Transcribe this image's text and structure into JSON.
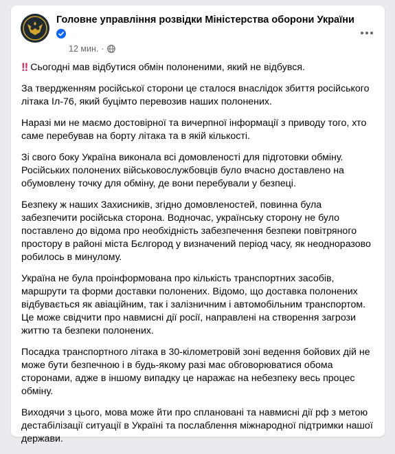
{
  "post": {
    "author": "Головне управління розвідки Міністерства оборони України",
    "verified": true,
    "time": "12 мин.",
    "separator": "·",
    "audience_icon": "globe-icon",
    "more_icon": "more-options-icon",
    "emoji": "‼",
    "paragraphs": [
      "Сьогодні мав відбутися обмін полоненими, який не відбувся.",
      "За твердженням російської сторони це сталося внаслідок збиття російського літака Іл-76, який буцімто перевозив наших полонених.",
      "Наразі ми не маємо достовірної та вичерпної інформації з приводу того, хто саме перебував на борту літака та в якій кількості.",
      "Зі свого боку Україна виконала всі домовленості для підготовки обміну. Російських полонених військовослужбовців було вчасно доставлено на обумовлену точку для обміну, де вони перебували у безпеці.",
      "Безпеку ж наших Захисників, згідно домовленостей, повинна була забезпечити російська сторона. Водночас, українську сторону не було поставлено до відома про необхідність забезпечення безпеки повітряного простору в районі міста Бєлгород у визначений період часу, як неодноразово робилось в минулому.",
      "Україна не була проінформована про кількість транспортних засобів, маршрути та форми доставки полонених. Відомо, що доставка полонених відбувається як авіаційним, так і залізничним і автомобільним транспортом. Це може свідчити про навмисні дії росії, направлені на створення загрози життю та безпеки полонених.",
      "Посадка транспортного літака в 30-кілометровій зоні ведення бойових дій не може бути безпечною і в будь-якому разі має обговорюватися обома сторонами, адже в іншому випадку це наражає на небезпеку весь процес обміну.",
      "Виходячи з цього, мова може йти про сплановані та навмисні дії рф з метою дестабілізації ситуації в Україні та послаблення міжнародної підтримки нашої держави."
    ]
  },
  "colors": {
    "background": "#e9ebee",
    "card": "#ffffff",
    "text": "#050505",
    "meta": "#65676b",
    "verified_badge": "#0866ff",
    "emoji": "#e0245e",
    "avatar_bg": "#1f2a33",
    "emblem_gold": "#d4a72c"
  }
}
